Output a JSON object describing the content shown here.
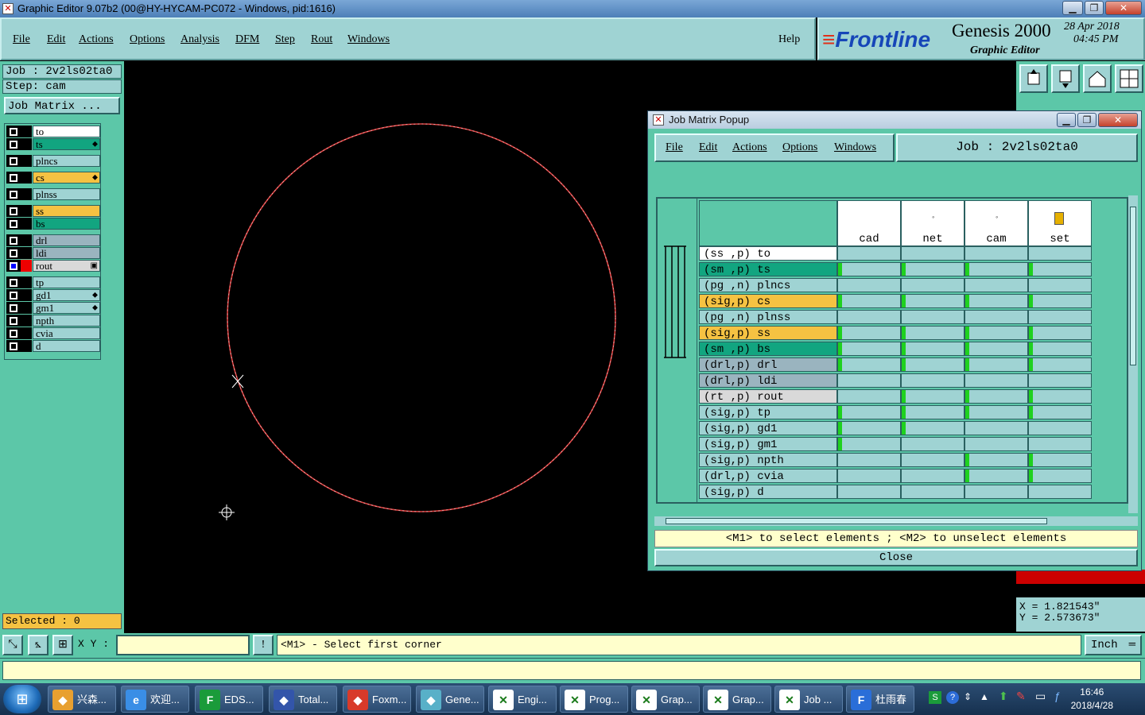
{
  "window": {
    "title": "Graphic Editor 9.07b2 (00@HY-HYCAM-PC072 - Windows, pid:1616)"
  },
  "menubar": {
    "items": [
      "File",
      "Edit",
      "Actions",
      "Options",
      "Analysis",
      "DFM",
      "Step",
      "Rout",
      "Windows"
    ],
    "help": "Help"
  },
  "brand": {
    "logo": "Frontline",
    "product": "Genesis 2000",
    "subtitle": "Graphic Editor",
    "date": "28 Apr 2018",
    "time": "04:45 PM"
  },
  "left": {
    "job": "Job : 2v2ls02ta0",
    "step": "Step: cam",
    "job_matrix_btn": "Job Matrix ...",
    "layers": [
      {
        "name": "to",
        "color": "#ffffff",
        "mark": ""
      },
      {
        "name": "ts",
        "color": "#12a580",
        "mark": "⬥"
      },
      {
        "name": "plncs",
        "color": "#9fd3d3",
        "mark": ""
      },
      {
        "name": "cs",
        "color": "#f5c242",
        "mark": "⬥"
      },
      {
        "name": "plnss",
        "color": "#9fd3d3",
        "mark": ""
      },
      {
        "name": "ss",
        "color": "#f5c242",
        "mark": ""
      },
      {
        "name": "bs",
        "color": "#12a580",
        "mark": ""
      },
      {
        "name": "drl",
        "color": "#9ab4bf",
        "mark": ""
      },
      {
        "name": "ldi",
        "color": "#9ab4bf",
        "mark": ""
      },
      {
        "name": "rout",
        "color": "#d9d9d9",
        "mark": "▣"
      },
      {
        "name": "tp",
        "color": "#9fd3d3",
        "mark": ""
      },
      {
        "name": "gd1",
        "color": "#9fd3d3",
        "mark": "⬥"
      },
      {
        "name": "gm1",
        "color": "#9fd3d3",
        "mark": "⬥"
      },
      {
        "name": "npth",
        "color": "#9fd3d3",
        "mark": ""
      },
      {
        "name": "cvia",
        "color": "#9fd3d3",
        "mark": ""
      },
      {
        "name": "d",
        "color": "#9fd3d3",
        "mark": ""
      }
    ],
    "selected": "Selected : 0"
  },
  "coords": {
    "x": "X = 1.821543\"",
    "y": "Y = 2.573673\""
  },
  "popup": {
    "title": "Job Matrix Popup",
    "menu": [
      "File",
      "Edit",
      "Actions",
      "Options",
      "Windows"
    ],
    "job": "Job : 2v2ls02ta0",
    "steps": [
      "cad",
      "net",
      "cam",
      "set"
    ],
    "rows": [
      {
        "label": "(ss ,p) to",
        "color": "#ffffff",
        "green": [
          false,
          false,
          false,
          false
        ]
      },
      {
        "label": "(sm ,p) ts",
        "color": "#12a580",
        "green": [
          true,
          true,
          true,
          true
        ]
      },
      {
        "label": "(pg ,n) plncs",
        "color": "#9fd3d3",
        "green": [
          false,
          false,
          false,
          false
        ]
      },
      {
        "label": "(sig,p) cs",
        "color": "#f5c242",
        "green": [
          true,
          true,
          true,
          true
        ]
      },
      {
        "label": "(pg ,n) plnss",
        "color": "#9fd3d3",
        "green": [
          false,
          false,
          false,
          false
        ]
      },
      {
        "label": "(sig,p) ss",
        "color": "#f5c242",
        "green": [
          true,
          true,
          true,
          true
        ]
      },
      {
        "label": "(sm ,p) bs",
        "color": "#12a580",
        "green": [
          true,
          true,
          true,
          true
        ]
      },
      {
        "label": "(drl,p) drl",
        "color": "#9ab4bf",
        "green": [
          true,
          true,
          true,
          true
        ]
      },
      {
        "label": "(drl,p) ldi",
        "color": "#9ab4bf",
        "green": [
          false,
          false,
          false,
          false
        ]
      },
      {
        "label": "(rt ,p) rout",
        "color": "#d9d9d9",
        "green": [
          false,
          true,
          true,
          true
        ]
      },
      {
        "label": "(sig,p) tp",
        "color": "#9fd3d3",
        "green": [
          true,
          true,
          true,
          true
        ]
      },
      {
        "label": "(sig,p) gd1",
        "color": "#9fd3d3",
        "green": [
          true,
          true,
          false,
          false
        ]
      },
      {
        "label": "(sig,p) gm1",
        "color": "#9fd3d3",
        "green": [
          true,
          false,
          false,
          false
        ]
      },
      {
        "label": "(sig,p) npth",
        "color": "#9fd3d3",
        "green": [
          false,
          false,
          true,
          true
        ]
      },
      {
        "label": "(drl,p) cvia",
        "color": "#9fd3d3",
        "green": [
          false,
          false,
          true,
          true
        ]
      },
      {
        "label": "(sig,p) d",
        "color": "#9fd3d3",
        "green": [
          false,
          false,
          false,
          false
        ]
      }
    ],
    "hint": "<M1> to select elements ; <M2> to unselect elements",
    "close": "Close"
  },
  "status": {
    "xy_label": "X Y :",
    "xy_value": "",
    "message": "<M1> - Select first corner",
    "unit": "Inch"
  },
  "taskbar": {
    "tasks": [
      {
        "label": "兴森...",
        "icon": "shell-icon",
        "color": "#e8a030"
      },
      {
        "label": "欢迎...",
        "icon": "ie-icon",
        "color": "#3a8ee6"
      },
      {
        "label": "EDS...",
        "icon": "eds-icon",
        "color": "#1a9b3a"
      },
      {
        "label": "Total...",
        "icon": "floppy-icon",
        "color": "#3355aa"
      },
      {
        "label": "Foxm...",
        "icon": "foxmail-icon",
        "color": "#d83a2a"
      },
      {
        "label": "Gene...",
        "icon": "genesis-icon",
        "color": "#58b0c8"
      },
      {
        "label": "Engi...",
        "icon": "x-window-icon",
        "color": "#ffffff"
      },
      {
        "label": "Prog...",
        "icon": "x-window-icon",
        "color": "#ffffff"
      },
      {
        "label": "Grap...",
        "icon": "x-window-icon",
        "color": "#ffffff"
      },
      {
        "label": "Grap...",
        "icon": "x-window-icon",
        "color": "#ffffff"
      },
      {
        "label": "Job ...",
        "icon": "x-window-icon",
        "color": "#ffffff"
      },
      {
        "label": "杜雨春",
        "icon": "app-f-icon",
        "color": "#2a6ed8"
      }
    ],
    "time": "16:46",
    "date": "2018/4/28"
  }
}
